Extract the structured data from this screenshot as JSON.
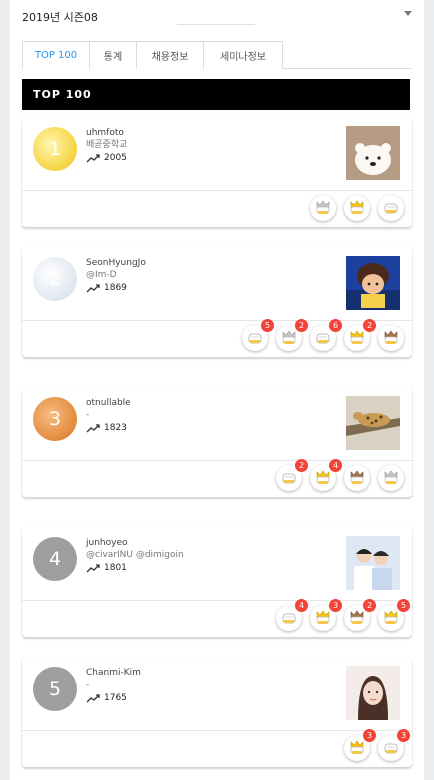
{
  "season": {
    "label": "2019년 시즌08"
  },
  "tabs": [
    {
      "label": "TOP 100"
    },
    {
      "label": "통계"
    },
    {
      "label": "채용정보"
    },
    {
      "label": "세미나정보"
    }
  ],
  "banner": {
    "title": "TOP 100"
  },
  "colors": {
    "accent": "#2196f3",
    "badge_count": "#f44336",
    "gold": "#f5d340",
    "silver": "#dfe5ef",
    "bronze": "#e48a3c",
    "grey": "#9e9e9e"
  },
  "users": [
    {
      "rank": "1",
      "name": "uhmfoto",
      "school": "배곧중학교",
      "score": "2005",
      "photo_icon": "bear-photo",
      "badges": [
        {
          "icon": "silver-crown-icon",
          "count": ""
        },
        {
          "icon": "gold-crown-icon",
          "count": ""
        },
        {
          "icon": "plain-badge-icon",
          "count": ""
        }
      ]
    },
    {
      "rank": "2",
      "name": "SeonHyungJo",
      "school": "@Im-D",
      "score": "1869",
      "photo_icon": "character-photo",
      "badges": [
        {
          "icon": "plain-badge-icon",
          "count": "5"
        },
        {
          "icon": "silver-crown-icon",
          "count": "2"
        },
        {
          "icon": "plain-badge-icon",
          "count": "6"
        },
        {
          "icon": "gold-crown-icon",
          "count": "2"
        },
        {
          "icon": "bronze-crown-icon",
          "count": ""
        }
      ]
    },
    {
      "rank": "3",
      "name": "otnullable",
      "school": "-",
      "score": "1823",
      "photo_icon": "leopard-photo",
      "badges": [
        {
          "icon": "plain-badge-icon",
          "count": "2"
        },
        {
          "icon": "gold-crown-icon",
          "count": "4"
        },
        {
          "icon": "bronze-crown-icon",
          "count": ""
        },
        {
          "icon": "silver-crown-icon",
          "count": ""
        }
      ]
    },
    {
      "rank": "4",
      "name": "junhoyeo",
      "school": "@civarINU @dimigoin",
      "score": "1801",
      "photo_icon": "people-photo",
      "badges": [
        {
          "icon": "plain-badge-icon",
          "count": "4"
        },
        {
          "icon": "gold-crown-icon",
          "count": "3"
        },
        {
          "icon": "bronze-crown-icon",
          "count": "2"
        },
        {
          "icon": "gold-crown-icon",
          "count": "5"
        }
      ]
    },
    {
      "rank": "5",
      "name": "Chanmi-Kim",
      "school": "-",
      "score": "1765",
      "photo_icon": "portrait-photo",
      "badges": [
        {
          "icon": "gold-crown-icon",
          "count": "3"
        },
        {
          "icon": "plain-badge-icon",
          "count": "3"
        }
      ]
    }
  ]
}
